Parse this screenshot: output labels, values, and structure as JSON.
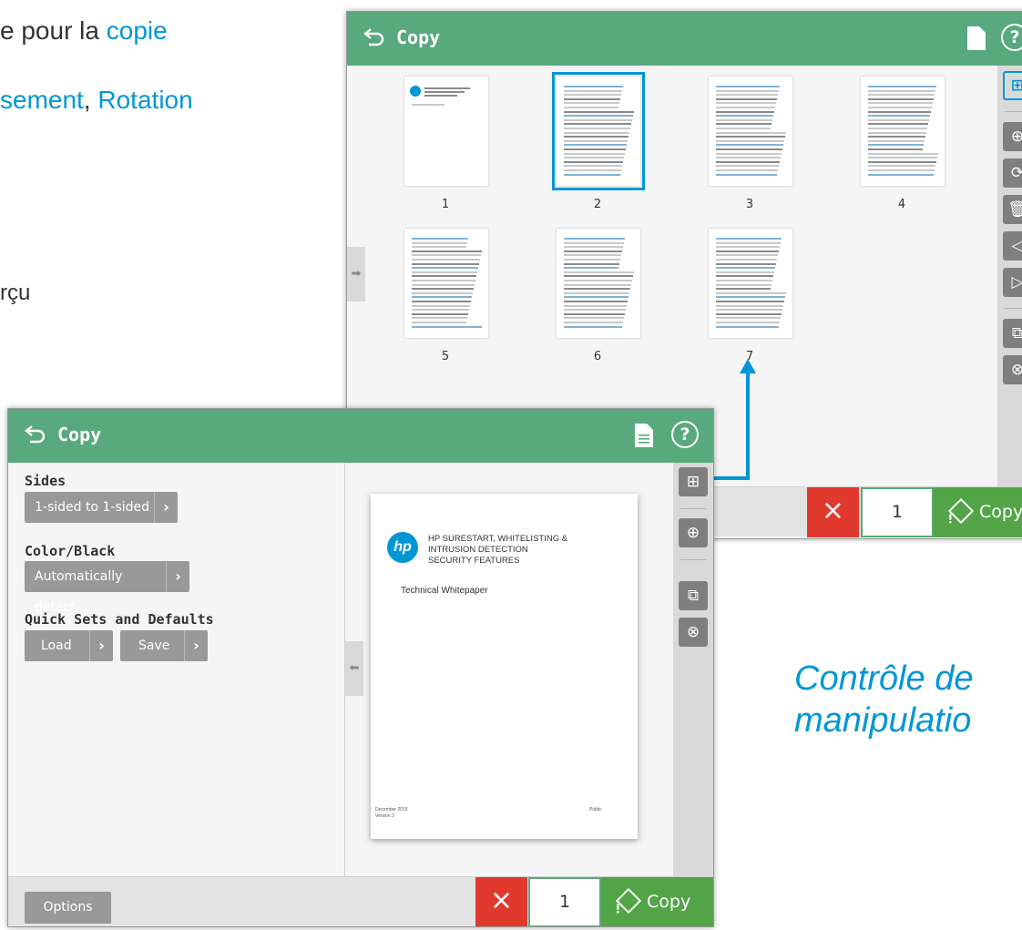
{
  "background": {
    "line1_prefix": "e pour la ",
    "line1_link": "copie",
    "line2_part1": "sement",
    "line2_sep": ", ",
    "line2_part2": "Rotation",
    "line3": "rçu",
    "caption_line1": "Contrôle de",
    "caption_line2": "manipulatio"
  },
  "thumbnail_window": {
    "title": "Copy",
    "thumbnails": [
      {
        "number": "1",
        "selected": false
      },
      {
        "number": "2",
        "selected": true
      },
      {
        "number": "3",
        "selected": false
      },
      {
        "number": "4",
        "selected": false
      },
      {
        "number": "5",
        "selected": false
      },
      {
        "number": "6",
        "selected": false
      },
      {
        "number": "7",
        "selected": false
      }
    ],
    "toolbar_icons": [
      "grid-view-icon",
      "zoom-in-icon",
      "rotate-icon",
      "delete-icon",
      "move-left-icon",
      "move-right-icon",
      "add-pages-icon",
      "clear-preview-icon"
    ],
    "copies": "1",
    "copy_label": "Copy"
  },
  "settings_window": {
    "title": "Copy",
    "sides_label": "Sides",
    "sides_value": "1-sided to 1-sided",
    "color_label": "Color/Black",
    "color_value": "Automatically detect",
    "quicksets_label": "Quick Sets and Defaults",
    "load_label": "Load",
    "save_label": "Save",
    "options_label": "Options",
    "copies": "1",
    "copy_label": "Copy",
    "preview": {
      "title_line1": "HP SURESTART, WHITELISTING &",
      "title_line2": "INTRUSION DETECTION",
      "subtitle": "SECURITY FEATURES",
      "doc_type": "Technical Whitepaper",
      "date": "December 2015",
      "version": "Version 2",
      "classification": "Public",
      "logo_text": "hp"
    },
    "toolbar_icons": [
      "grid-view-icon",
      "zoom-in-icon",
      "add-pages-icon",
      "clear-preview-icon"
    ]
  },
  "colors": {
    "titlebar": "#58a97d",
    "accent": "#0096d6",
    "cancel": "#e2392f",
    "copy": "#52a447"
  }
}
